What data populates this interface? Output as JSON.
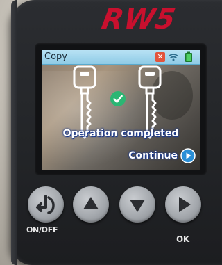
{
  "device": {
    "brand": "RW5",
    "brand_color": "#c8102e"
  },
  "screen": {
    "title": "Copy",
    "titlebar_color": "#a6d8ee",
    "icons": [
      "close-icon",
      "wifi-icon",
      "battery-icon"
    ],
    "illustration": [
      "key-icon",
      "success-check-icon",
      "key-icon"
    ],
    "status_message": "Operation completed",
    "continue_label": "Continue",
    "continue_icon": "play-circle-icon",
    "accent_color": "#2a8fd6",
    "success_color": "#2bb673"
  },
  "hardware_buttons": [
    {
      "name": "power",
      "icon": "power-back-icon",
      "label": "ON/OFF"
    },
    {
      "name": "up",
      "icon": "up-arrow-icon",
      "label": ""
    },
    {
      "name": "down",
      "icon": "down-arrow-icon",
      "label": ""
    },
    {
      "name": "ok",
      "icon": "right-arrow-icon",
      "label": "OK"
    }
  ]
}
